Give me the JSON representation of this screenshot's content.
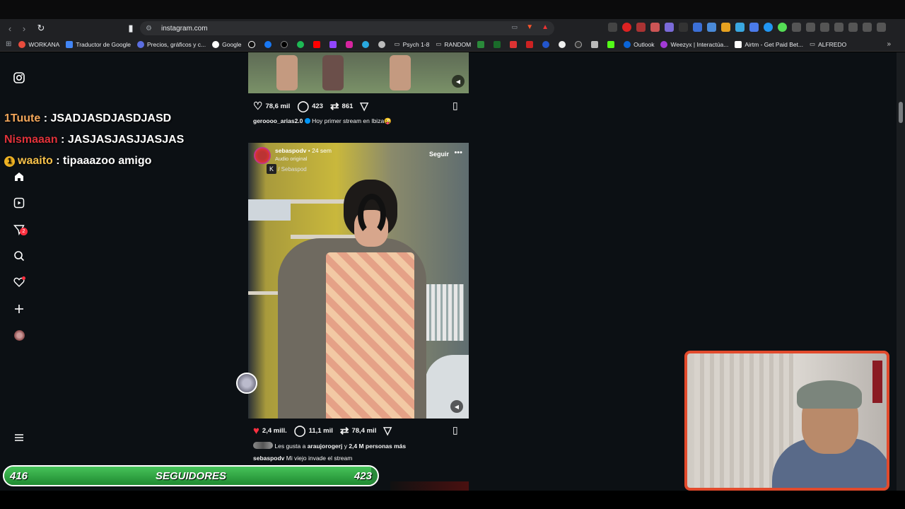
{
  "browser": {
    "url": "instagram.com",
    "bookmarks": [
      "WORKANA",
      "Traductor de Google",
      "Precios, gráficos y c...",
      "Google",
      "Psych 1-8",
      "RANDOM",
      "Outlook",
      "Weezyx | Interactúa...",
      "Airtm - Get Paid Bet...",
      "ALFREDO"
    ]
  },
  "chat": [
    {
      "user": "1Tuute",
      "message": " : JSADJASDJASDJASD"
    },
    {
      "user": "Nismaaan",
      "message": " : JASJASJASJJASJAS"
    },
    {
      "user": "waaito",
      "badge": "1",
      "message": " : tipaaazoo amigo"
    }
  ],
  "sidebar": {
    "notification_count": "2",
    "icons": [
      "instagram-icon",
      "home-icon",
      "reels-icon",
      "send-icon",
      "search-icon",
      "heart-icon",
      "create-icon",
      "profile-avatar",
      "menu-icon"
    ]
  },
  "post1": {
    "likes": "78,6 mil",
    "comments": "423",
    "shares": "861",
    "username": "geroooo_arias2.0",
    "caption": "Hoy primer stream en Ibiza😜"
  },
  "reel": {
    "username": "sebaspodv",
    "time": "• 24 sem",
    "audio": "Audio original",
    "audio_tag": "/ Sebaspod",
    "follow": "Seguir",
    "likes": "2,4 mill.",
    "comments": "11,1 mil",
    "shares": "78,4 mil",
    "liked_by_prefix": "Les gusta a",
    "liked_by_user": "araujorogerj",
    "liked_by_mid": "y",
    "liked_by_count": "2,4 M personas más",
    "caption_user": "sebaspodv",
    "caption": "Mi viejo invade el stream"
  },
  "followers_bar": {
    "current": "416",
    "label": "SEGUIDORES",
    "goal": "423",
    "progress": 0.983
  },
  "colors": {
    "accent_red": "#e0323a",
    "bar_green": "#47c35a",
    "cam_border": "#e24a2c"
  }
}
